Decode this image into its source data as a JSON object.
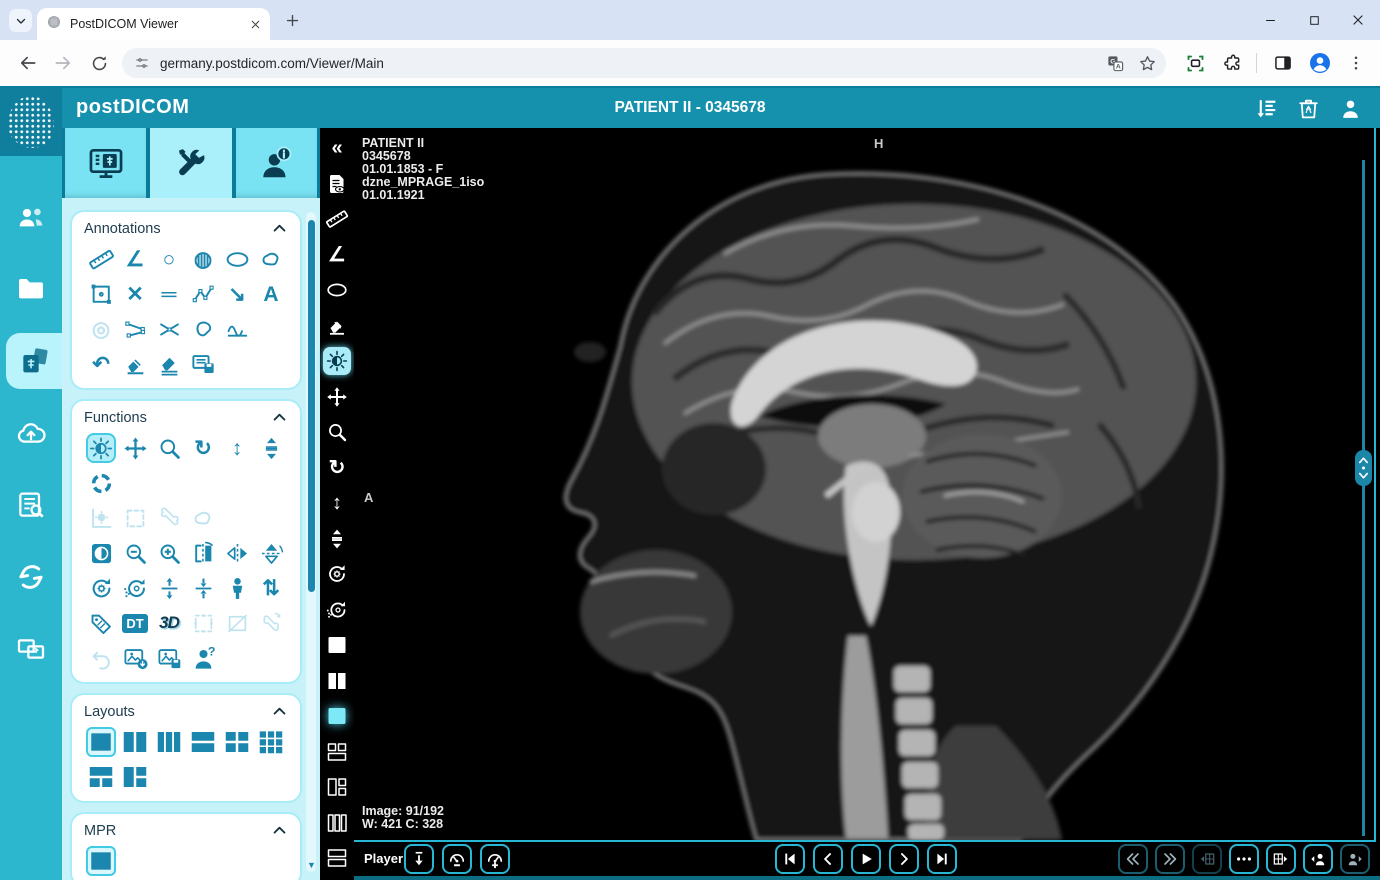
{
  "browser": {
    "tab_title": "PostDICOM Viewer",
    "url": "germany.postdicom.com/Viewer/Main"
  },
  "app_header": {
    "logo_text": "postDICOM",
    "title": "PATIENT II - 0345678",
    "actions": [
      {
        "n": "sort-list"
      },
      {
        "n": "trash"
      },
      {
        "n": "account"
      }
    ]
  },
  "nav_sidebar": {
    "items": [
      {
        "n": "users"
      },
      {
        "n": "folder"
      },
      {
        "n": "image-gallery",
        "active": true
      },
      {
        "n": "cloud-upload"
      },
      {
        "n": "search-list"
      },
      {
        "n": "sync"
      },
      {
        "n": "screen-share"
      }
    ]
  },
  "tool_panel": {
    "tabs": [
      {
        "n": "viewer-monitor"
      },
      {
        "n": "tools",
        "active": true
      },
      {
        "n": "patient-info"
      }
    ],
    "annotations": {
      "title": "Annotations",
      "icons": [
        {
          "n": "ruler"
        },
        {
          "n": "angle"
        },
        {
          "n": "circle"
        },
        {
          "n": "hatched-circle"
        },
        {
          "n": "ellipse"
        },
        {
          "n": "freehand"
        },
        {
          "n": "rect-roi"
        },
        {
          "n": "cross-measure"
        },
        {
          "n": "parallel-lines"
        },
        {
          "n": "polyline"
        },
        {
          "n": "arrow"
        },
        {
          "n": "text-label"
        },
        {
          "n": "crosshair-target",
          "disabled": true
        },
        {
          "n": "cobb-angle"
        },
        {
          "n": "angle-multi"
        },
        {
          "n": "closed-freehand"
        },
        {
          "n": "spline-wave"
        },
        {
          "n": "spacer"
        },
        {
          "n": "undo"
        },
        {
          "n": "eraser"
        },
        {
          "n": "eraser-all"
        },
        {
          "n": "save-annotations"
        }
      ]
    },
    "functions": {
      "title": "Functions",
      "icons": [
        {
          "n": "window-level",
          "active": true
        },
        {
          "n": "pan"
        },
        {
          "n": "magnify"
        },
        {
          "n": "rotate"
        },
        {
          "n": "scroll-vertical"
        },
        {
          "n": "stack-scroll"
        },
        {
          "n": "target-circle"
        },
        {
          "n": "spacer"
        },
        {
          "n": "spacer"
        },
        {
          "n": "spacer"
        },
        {
          "n": "spacer"
        },
        {
          "n": "spacer"
        },
        {
          "n": "histogram-wl",
          "disabled": true
        },
        {
          "n": "roi-dashed",
          "disabled": true
        },
        {
          "n": "bone",
          "disabled": true
        },
        {
          "n": "freehand-roi",
          "disabled": true
        },
        {
          "n": "spacer"
        },
        {
          "n": "spacer"
        },
        {
          "n": "invert"
        },
        {
          "n": "zoom-out"
        },
        {
          "n": "zoom-in"
        },
        {
          "n": "flip-page"
        },
        {
          "n": "flip-horizontal"
        },
        {
          "n": "flip-vertical"
        },
        {
          "n": "reset-rotate"
        },
        {
          "n": "reset-window"
        },
        {
          "n": "expand-vertical"
        },
        {
          "n": "collapse-vertical"
        },
        {
          "n": "patient-orientation"
        },
        {
          "n": "sort-updown"
        },
        {
          "n": "tag"
        },
        {
          "n": "dt"
        },
        {
          "n": "threed"
        },
        {
          "n": "select-dashed",
          "disabled": true
        },
        {
          "n": "crop",
          "disabled": true
        },
        {
          "n": "bone-rotate",
          "disabled": true
        },
        {
          "n": "undo-shape",
          "disabled": true
        },
        {
          "n": "image-download"
        },
        {
          "n": "image-save"
        },
        {
          "n": "patient-query"
        }
      ]
    },
    "layouts": {
      "title": "Layouts",
      "icons": [
        {
          "n": "layout-1x1",
          "active": true
        },
        {
          "n": "layout-1x2"
        },
        {
          "n": "layout-1x3"
        },
        {
          "n": "layout-2x1"
        },
        {
          "n": "layout-2x2"
        },
        {
          "n": "layout-3x3"
        },
        {
          "n": "layout-1top-2bottom"
        },
        {
          "n": "layout-1left-2right"
        }
      ]
    },
    "mpr": {
      "title": "MPR",
      "icons": [
        {
          "n": "mpr-cut",
          "active": true
        }
      ]
    }
  },
  "toolbar": {
    "icons": [
      {
        "n": "collapse-panel"
      },
      {
        "n": "report-view"
      },
      {
        "n": "ruler"
      },
      {
        "n": "angle"
      },
      {
        "n": "ellipse"
      },
      {
        "n": "eraser"
      },
      {
        "n": "window-level",
        "active": true
      },
      {
        "n": "pan"
      },
      {
        "n": "magnify"
      },
      {
        "n": "rotate"
      },
      {
        "n": "scroll-vertical"
      },
      {
        "n": "stack-scroll"
      },
      {
        "n": "reset-rotate"
      },
      {
        "n": "reset-window"
      },
      {
        "n": "layout-1x1-filled"
      },
      {
        "n": "layout-1x2-filled"
      },
      {
        "n": "layout-current",
        "current": true
      },
      {
        "n": "o-2top-1bottom"
      },
      {
        "n": "o-1left-2right"
      },
      {
        "n": "o-3col"
      },
      {
        "n": "o-2row"
      }
    ]
  },
  "viewer": {
    "patient_name": "PATIENT II",
    "patient_id": "0345678",
    "birth": "01.01.1853 - F",
    "series": "dzne_MPRAGE_1iso",
    "date": "01.01.1921",
    "orientation_top": "H",
    "orientation_left": "A",
    "image_info": "Image: 91/192",
    "window_info": "W: 421 C: 328"
  },
  "player": {
    "label": "Player",
    "speed_controls": [
      {
        "n": "play-direction"
      },
      {
        "n": "speed-down"
      },
      {
        "n": "speed-up"
      }
    ],
    "nav_controls": [
      {
        "n": "nav-first"
      },
      {
        "n": "nav-prev"
      },
      {
        "n": "nav-play"
      },
      {
        "n": "nav-next"
      },
      {
        "n": "nav-last"
      }
    ],
    "series_controls": [
      {
        "n": "fast-backward",
        "dim": true
      },
      {
        "n": "fast-forward",
        "dim": true
      },
      {
        "n": "series-prev",
        "disabled": true
      },
      {
        "n": "more-options"
      },
      {
        "n": "series-next"
      },
      {
        "n": "patient-prev"
      },
      {
        "n": "patient-next",
        "dim": true
      }
    ]
  },
  "colors": {
    "header_teal": "#1591ae",
    "sidebar_teal": "#2db7cf",
    "panel_cyan": "#c8f2fa",
    "accent_cyan": "#27b6d3",
    "icon_teal": "#1b86ae"
  }
}
